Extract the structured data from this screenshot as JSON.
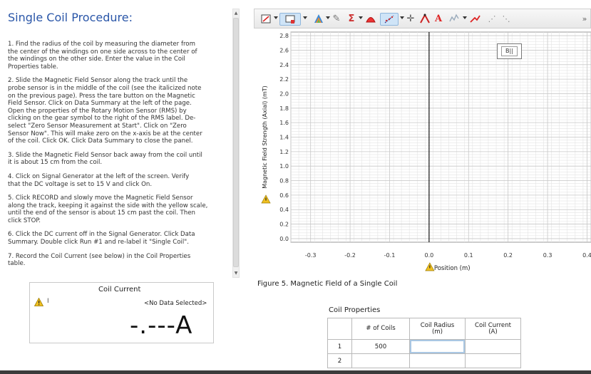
{
  "procedure": {
    "title": "Single Coil Procedure:",
    "steps": [
      "1.  Find the radius of the coil by measuring the diameter from\nthe center of the windings on one side across to the center of\nthe windings on the other side.  Enter the value in the Coil\nProperties table.",
      "2.  Slide the Magnetic Field Sensor along the track until the\nprobe sensor is in the middle of the coil (see the italicized note\non the previous page). Press the tare button on the Magnetic\nField Sensor.  Click on Data Summary at the left of the page.\nOpen the properties of the Rotary Motion Sensor (RMS) by\nclicking on the gear symbol to the right of the RMS label.  De-\nselect \"Zero Sensor Measurement at Start\".  Click on \"Zero\nSensor Now\". This will make zero on the x-axis be at the center\nof the coil.  Click OK.  Click Data Summary to close the panel.",
      "3.  Slide the Magnetic Field Sensor back away from the coil until\nit is about 15 cm from the coil.",
      "4.  Click on Signal Generator at the left of the screen.  Verify\nthat the DC voltage is set to 15 V and click On.",
      "5.  Click RECORD and slowly move the Magnetic Field Sensor\nalong the track, keeping it against the side with the yellow scale,\nuntil the end of the sensor is about 15 cm past the coil. Then\nclick STOP.",
      "6. Click the DC current off in the Signal Generator.  Click Data\nSummary.  Double click Run #1 and re-label it \"Single Coil\".",
      "7. Record the Coil Current (see below) in the Coil Properties\ntable."
    ]
  },
  "coil_current": {
    "title": "Coil Current",
    "bar_glyph": "I",
    "no_data": "<No Data Selected>",
    "value": "-.---",
    "unit": "A"
  },
  "toolbar": {
    "icons": [
      "scale-to-fit-icon",
      "select-range-icon",
      "data-color-icon",
      "highlight-icon",
      "statistics-icon",
      "area-icon",
      "curve-fit-icon",
      "coordinates-icon",
      "slope-icon",
      "annotation-icon",
      "add-data-icon",
      "delta-icon",
      "points-icon",
      "more-points-icon"
    ],
    "overflow": "»"
  },
  "chart_data": {
    "type": "scatter",
    "title": "",
    "xlabel": "Position (m)",
    "ylabel": "Magnetic Field Strength (Axial) (mT)",
    "xlim": [
      -0.35,
      0.41
    ],
    "ylim": [
      -0.05,
      2.85
    ],
    "x_ticks": [
      "-0.3",
      "-0.2",
      "-0.1",
      "0.0",
      "0.1",
      "0.2",
      "0.3",
      "0.4"
    ],
    "y_ticks": [
      "0.0",
      "0.2",
      "0.4",
      "0.6",
      "0.8",
      "1.0",
      "1.2",
      "1.4",
      "1.6",
      "1.8",
      "2.0",
      "2.2",
      "2.4",
      "2.6",
      "2.8"
    ],
    "grid": true,
    "series": [],
    "legend_label": "B||",
    "zero_line_color": "#000000"
  },
  "figure_caption": "Figure 5. Magnetic Field of a Single Coil",
  "coil_properties": {
    "title": "Coil Properties",
    "headers": [
      "# of Coils",
      "Coil Radius\n(m)",
      "Coil Current\n(A)"
    ],
    "rows": [
      {
        "idx": "1",
        "coils": "500",
        "radius": "",
        "current": ""
      },
      {
        "idx": "2",
        "coils": "",
        "radius": "",
        "current": ""
      }
    ]
  },
  "colors": {
    "title": "#2a56a8",
    "grid_minor": "#e4e4e4",
    "grid_major": "#c8c8c8",
    "warning": "#f0c020"
  }
}
